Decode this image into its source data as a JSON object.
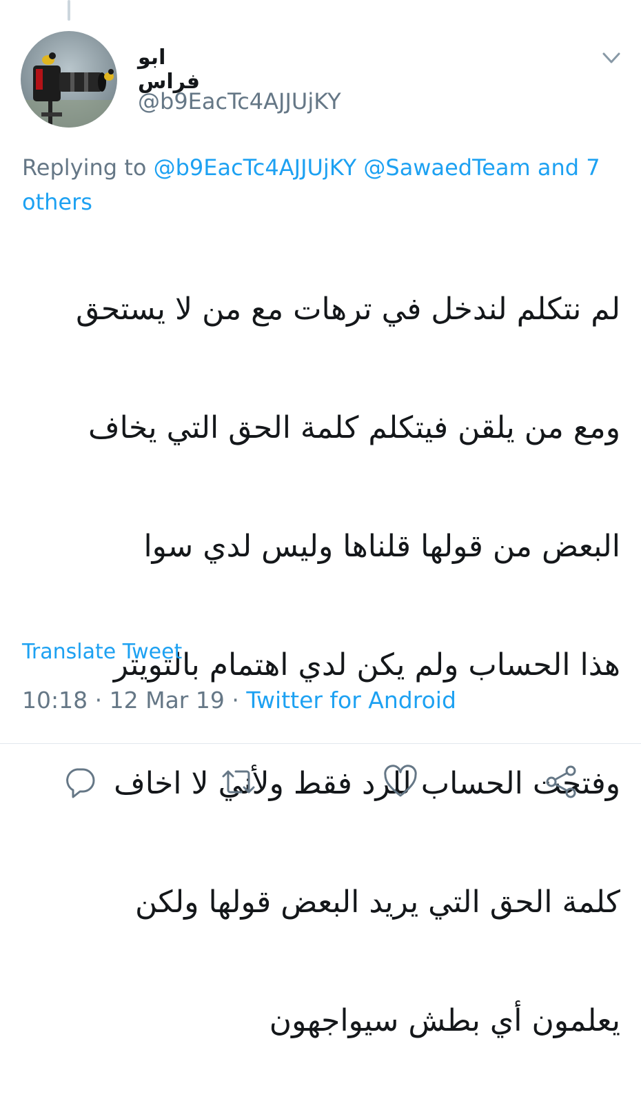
{
  "tweet": {
    "author": {
      "display_name": "ابو فراس",
      "handle": "@b9EacTc4AJJUjKY",
      "avatar_icon": "camera-with-birds-avatar"
    },
    "replying": {
      "prefix": "Replying to",
      "mentions": [
        "@b9EacTc4AJJUjKY",
        "@SawaedTeam"
      ],
      "others": "and 7 others"
    },
    "text_lines": [
      "لم نتكلم لندخل في ترهات مع من لا يستحق",
      "ومع من يلقن فيتكلم كلمة الحق التي يخاف",
      "البعض من قولها قلناها وليس لدي سوا",
      "هذا الحساب ولم يكن لدي اهتمام بالتويتر",
      "وفتحت الحساب للرد فقط ولأني لا اخاف",
      "كلمة الحق التي يريد البعض قولها ولكن",
      "يعلمون أي بطش سيواجهون"
    ],
    "translate_label": "Translate Tweet",
    "time": "10:18",
    "date": "12 Mar 19",
    "separator": "·",
    "source": "Twitter for Android"
  },
  "actions": [
    {
      "name": "reply",
      "icon": "reply-icon"
    },
    {
      "name": "retweet",
      "icon": "retweet-icon"
    },
    {
      "name": "like",
      "icon": "heart-icon"
    },
    {
      "name": "share",
      "icon": "share-icon"
    }
  ],
  "colors": {
    "link": "#1da1f2",
    "secondary": "#657786",
    "text": "#14171a"
  }
}
